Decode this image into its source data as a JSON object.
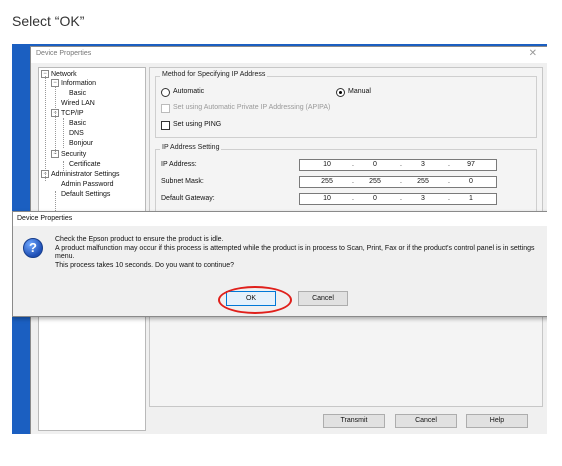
{
  "instruction": "Select “OK”",
  "main_window": {
    "title": "Device Properties",
    "close_glyph": "✕",
    "tree": [
      {
        "label": "Network"
      },
      {
        "label": "Information"
      },
      {
        "label": "Basic"
      },
      {
        "label": "Wired LAN"
      },
      {
        "label": "TCP/IP"
      },
      {
        "label": "Basic"
      },
      {
        "label": "DNS"
      },
      {
        "label": "Bonjour"
      },
      {
        "label": "Security"
      },
      {
        "label": "Certificate"
      },
      {
        "label": "Administrator Settings"
      },
      {
        "label": "Admin Password"
      },
      {
        "label": "Default Settings"
      }
    ],
    "method_group": {
      "title": "Method for Specifying IP Address",
      "automatic": "Automatic",
      "manual": "Manual",
      "manual_selected": true,
      "apipa": "Set using Automatic Private IP Addressing (APIPA)",
      "ping": "Set using PING"
    },
    "ip_group": {
      "title": "IP Address Setting",
      "rows": [
        {
          "label": "IP Address:",
          "values": [
            "10",
            "0",
            "3",
            "97"
          ]
        },
        {
          "label": "Subnet Mask:",
          "values": [
            "255",
            "255",
            "255",
            "0"
          ]
        },
        {
          "label": "Default Gateway:",
          "values": [
            "10",
            "0",
            "3",
            "1"
          ]
        }
      ],
      "separator": "."
    },
    "buttons": {
      "transmit": "Transmit",
      "cancel": "Cancel",
      "help": "Help"
    }
  },
  "dialog": {
    "title": "Device Properties",
    "close_glyph": "✕",
    "icon_glyph": "?",
    "lines": [
      "Check the Epson product to ensure the product is idle.",
      "A product malfunction may occur if this process is attempted while the product is in process to Scan, Print, Fax or if the product's control panel is in settings menu.",
      "This process takes 10 seconds. Do you want to continue?"
    ],
    "ok": "OK",
    "cancel": "Cancel"
  },
  "colors": {
    "desktop": "#1b5fc1",
    "highlight": "#e0201b",
    "default_button_border": "#0078d7"
  }
}
